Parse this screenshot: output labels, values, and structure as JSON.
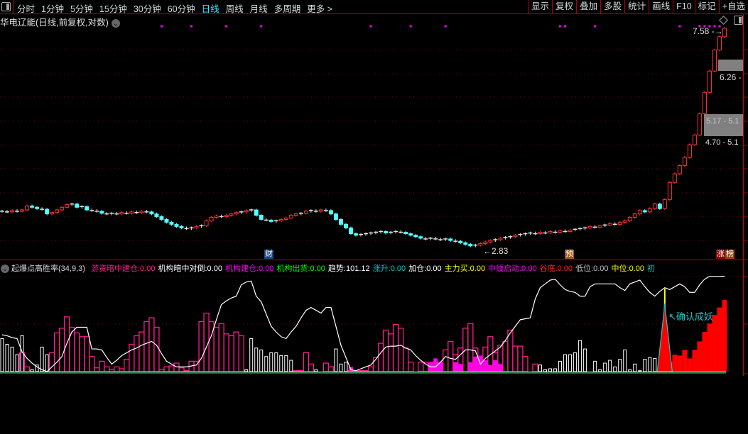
{
  "toolbar": {
    "periods": [
      "分时",
      "1分钟",
      "5分钟",
      "15分钟",
      "30分钟",
      "60分钟",
      "日线",
      "周线",
      "月线",
      "多周期",
      "更多 >"
    ],
    "active_period": "日线",
    "buttons": [
      "显示",
      "复权",
      "叠加",
      "多股",
      "统计",
      "画线",
      "F10",
      "标记",
      "+自选"
    ]
  },
  "chart_title": "华电辽能(日线,前复权,对数)",
  "price_labels": {
    "high": "7.58",
    "low": "2.83",
    "level1": "6.26 -",
    "level2_box": "5.17 - 5.1",
    "level3": "4.70 - 5.1"
  },
  "markers": {
    "cai": "财",
    "yu": "预",
    "zhang": "涨",
    "bang": "榜"
  },
  "annotation": "确认成妖",
  "indicator": {
    "name": "起爆点高胜率(34,9,3)",
    "items": [
      {
        "label": "游资暗中建仓:",
        "value": "0.00",
        "color": "#ff1a8c"
      },
      {
        "label": "机构暗中对倒:",
        "value": "0.00",
        "color": "#ffffff"
      },
      {
        "label": "机构建仓:",
        "value": "0.00",
        "color": "#ff00ff"
      },
      {
        "label": "机构出货:",
        "value": "0.00",
        "color": "#00ff00"
      },
      {
        "label": "趋势:",
        "value": "101.12",
        "color": "#ffffff"
      },
      {
        "label": "涨升:",
        "value": "0.00",
        "color": "#00c8c8"
      },
      {
        "label": "加仓:",
        "value": "0.00",
        "color": "#ffffff"
      },
      {
        "label": "主力买:",
        "value": "0.00",
        "color": "#ffff00"
      },
      {
        "label": "中线启动:",
        "value": "0.00",
        "color": "#ff00ff"
      },
      {
        "label": "谷底:",
        "value": "0.00",
        "color": "#ff2020"
      },
      {
        "label": "低位:",
        "value": "0.00",
        "color": "#c0c0c0"
      },
      {
        "label": "中位:",
        "value": "0.00",
        "color": "#ffff00"
      },
      {
        "label": "初",
        "value": "",
        "color": "#00c8c8"
      }
    ]
  },
  "colors": {
    "up": "#ff3232",
    "down": "#54ffff",
    "grid": "#8b0000",
    "accent": "#40e0ff"
  },
  "chart_data": [
    {
      "type": "candlestick",
      "scale": "log",
      "closes": [
        3.34,
        3.33,
        3.35,
        3.34,
        3.36,
        3.42,
        3.4,
        3.38,
        3.37,
        3.3,
        3.32,
        3.36,
        3.4,
        3.44,
        3.45,
        3.4,
        3.41,
        3.36,
        3.35,
        3.34,
        3.31,
        3.3,
        3.31,
        3.3,
        3.32,
        3.31,
        3.33,
        3.32,
        3.34,
        3.33,
        3.3,
        3.26,
        3.22,
        3.18,
        3.15,
        3.12,
        3.1,
        3.09,
        3.1,
        3.12,
        3.13,
        3.2,
        3.25,
        3.27,
        3.26,
        3.28,
        3.3,
        3.32,
        3.33,
        3.35,
        3.36,
        3.28,
        3.22,
        3.21,
        3.19,
        3.2,
        3.22,
        3.24,
        3.28,
        3.3,
        3.31,
        3.34,
        3.35,
        3.34,
        3.36,
        3.35,
        3.3,
        3.22,
        3.15,
        3.1,
        3.02,
        3.0,
        3.01,
        3.02,
        3.03,
        3.04,
        3.05,
        3.03,
        3.04,
        3.05,
        3.04,
        3.02,
        3.0,
        2.98,
        2.96,
        2.95,
        2.96,
        2.95,
        2.94,
        2.95,
        2.93,
        2.92,
        2.9,
        2.88,
        2.86,
        2.87,
        2.89,
        2.91,
        2.93,
        2.94,
        2.96,
        2.97,
        2.98,
        3.0,
        3.01,
        3.02,
        3.03,
        3.02,
        3.04,
        3.03,
        3.05,
        3.04,
        3.06,
        3.05,
        3.07,
        3.08,
        3.09,
        3.1,
        3.12,
        3.11,
        3.13,
        3.14,
        3.16,
        3.15,
        3.18,
        3.2,
        3.25,
        3.3,
        3.35,
        3.33,
        3.38,
        3.45,
        3.38,
        3.52,
        3.8,
        3.95,
        4.1,
        4.25,
        4.5,
        4.7,
        5.17,
        5.69,
        6.26,
        6.88,
        7.3,
        7.58
      ],
      "signal_dot_indices": [
        32,
        38,
        45,
        52,
        74,
        82,
        89,
        112,
        113,
        119,
        136,
        140,
        141,
        142,
        143,
        144
      ]
    },
    {
      "type": "bar+line",
      "ylim": [
        0,
        101.12
      ],
      "trend": [
        39,
        38,
        36,
        35,
        21,
        14,
        9,
        5,
        2,
        0,
        5,
        10,
        16,
        30,
        42,
        47,
        47,
        47,
        24,
        24,
        23,
        15,
        8,
        12,
        17,
        20,
        23,
        25,
        28,
        30,
        32,
        28,
        19,
        11,
        8,
        5,
        5,
        5,
        6,
        7,
        14,
        26,
        38,
        55,
        71,
        75,
        78,
        80,
        92,
        95,
        96,
        80,
        74,
        61,
        48,
        42,
        37,
        35,
        42,
        48,
        57,
        65,
        68,
        65,
        62,
        68,
        68,
        48,
        28,
        15,
        2,
        1,
        3,
        5,
        7,
        13,
        20,
        26,
        27,
        27,
        28,
        25,
        23,
        17,
        12,
        8,
        5,
        5,
        10,
        16,
        14,
        13,
        18,
        23,
        23,
        22,
        8,
        14,
        18,
        22,
        26,
        33,
        41,
        48,
        55,
        56,
        57,
        77,
        89,
        93,
        97,
        98,
        92,
        87,
        85,
        84,
        80,
        80,
        90,
        93,
        93,
        93,
        93,
        93,
        89,
        86,
        93,
        95,
        97,
        90,
        84,
        80,
        85,
        89,
        87,
        90,
        93,
        90,
        84,
        84,
        92,
        98,
        101,
        101,
        101,
        101.12
      ],
      "youzi_jiancang": [
        0,
        0,
        0,
        0,
        20,
        5,
        0,
        0,
        0,
        0,
        20,
        41,
        46,
        58,
        47,
        41,
        37,
        37,
        16,
        4,
        11,
        5,
        2,
        5,
        3,
        13,
        29,
        38,
        42,
        53,
        57,
        47,
        2,
        5,
        6,
        9,
        4,
        1,
        11,
        11,
        53,
        62,
        53,
        47,
        51,
        40,
        38,
        42,
        38,
        0,
        0,
        0,
        0,
        0,
        0,
        0,
        0,
        0,
        0,
        1,
        1,
        20,
        8,
        0,
        0,
        9,
        5,
        0,
        0,
        0,
        1,
        1,
        1,
        1,
        5,
        15,
        30,
        44,
        40,
        50,
        46,
        25,
        10,
        0,
        10,
        10,
        5,
        10,
        0,
        23,
        32,
        18,
        25,
        46,
        51,
        25,
        0,
        26,
        37,
        20,
        28,
        32,
        44,
        27,
        27,
        16,
        0,
        8,
        0,
        0,
        0,
        0,
        0,
        0,
        0,
        0,
        0,
        0,
        0,
        0,
        0,
        0,
        0,
        0,
        0,
        0,
        0,
        0,
        0,
        0,
        0,
        0,
        0,
        0,
        0,
        0,
        0,
        0,
        0,
        0,
        0,
        0,
        0,
        0,
        0,
        0
      ],
      "jigou_jiancang": [
        0,
        0,
        0,
        0,
        0,
        0,
        0,
        0,
        0,
        0,
        0,
        0,
        0,
        0,
        0,
        0,
        0,
        0,
        0,
        0,
        0,
        0,
        0,
        0,
        0,
        0,
        0,
        0,
        0,
        0,
        0,
        0,
        0,
        0,
        0,
        0,
        0,
        0,
        0,
        0,
        0,
        0,
        0,
        0,
        0,
        0,
        0,
        0,
        0,
        0,
        0,
        0,
        0,
        0,
        0,
        0,
        0,
        0,
        0,
        0,
        0,
        0,
        0,
        0,
        0,
        0,
        0,
        0,
        0,
        0,
        5,
        0,
        0,
        0,
        0,
        0,
        0,
        0,
        0,
        0,
        0,
        0,
        0,
        0,
        0,
        0,
        10,
        14,
        10,
        0,
        0,
        10,
        8,
        0,
        10,
        16,
        17,
        12,
        7,
        12,
        8,
        0,
        0,
        0,
        0,
        0,
        0,
        0,
        0,
        0,
        0,
        0,
        0,
        0,
        0,
        0,
        0,
        0,
        0,
        0,
        0,
        0,
        0,
        0,
        0,
        0,
        0,
        0,
        0,
        0,
        0,
        0,
        0,
        0,
        0,
        0,
        0,
        0,
        0,
        0,
        0,
        0,
        0,
        0,
        0,
        0
      ],
      "jigou_duidao": [
        35,
        29,
        26,
        18,
        38,
        0,
        2,
        7,
        26,
        18,
        0,
        0,
        0,
        0,
        0,
        0,
        0,
        0,
        0,
        0,
        0,
        0,
        0,
        0,
        0,
        0,
        0,
        0,
        0,
        0,
        0,
        0,
        0,
        0,
        0,
        0,
        0,
        0,
        0,
        0,
        0,
        0,
        0,
        0,
        0,
        0,
        0,
        0,
        0,
        2,
        35,
        25,
        23,
        16,
        20,
        20,
        17,
        17,
        12,
        0,
        0,
        0,
        0,
        2,
        0,
        0,
        0,
        24,
        8,
        10,
        0,
        0,
        0,
        0,
        0,
        0,
        0,
        0,
        0,
        0,
        0,
        0,
        0,
        0,
        0,
        0,
        0,
        0,
        0,
        0,
        0,
        0,
        0,
        0,
        0,
        0,
        0,
        0,
        0,
        0,
        0,
        0,
        0,
        0,
        0,
        0,
        0,
        0,
        7,
        2,
        3,
        3,
        11,
        18,
        18,
        20,
        33,
        24,
        0,
        11,
        2,
        9,
        12,
        5,
        13,
        23,
        2,
        8,
        1,
        13,
        15,
        14,
        7,
        0,
        0,
        0,
        0,
        0,
        0,
        0,
        0,
        0,
        0,
        0,
        0,
        0
      ],
      "red_bars": [
        0,
        0,
        0,
        0,
        0,
        0,
        0,
        0,
        0,
        0,
        0,
        0,
        0,
        0,
        0,
        0,
        0,
        0,
        0,
        0,
        0,
        0,
        0,
        0,
        0,
        0,
        0,
        0,
        0,
        0,
        0,
        0,
        0,
        0,
        0,
        0,
        0,
        0,
        0,
        0,
        0,
        0,
        0,
        0,
        0,
        0,
        0,
        0,
        0,
        0,
        0,
        0,
        0,
        0,
        0,
        0,
        0,
        0,
        0,
        0,
        0,
        0,
        0,
        0,
        0,
        0,
        0,
        0,
        0,
        0,
        0,
        0,
        0,
        0,
        0,
        0,
        0,
        0,
        0,
        0,
        0,
        0,
        0,
        0,
        0,
        0,
        0,
        0,
        0,
        0,
        0,
        0,
        0,
        0,
        0,
        0,
        0,
        0,
        0,
        0,
        0,
        0,
        0,
        0,
        0,
        0,
        0,
        0,
        0,
        0,
        0,
        0,
        0,
        0,
        0,
        0,
        0,
        0,
        0,
        0,
        0,
        0,
        0,
        0,
        0,
        0,
        0,
        0,
        0,
        0,
        0,
        0,
        0,
        0,
        10,
        18,
        17,
        23,
        14,
        23,
        32,
        42,
        51,
        60,
        68,
        76
      ],
      "spike_index": 133,
      "spike_value": 80
    }
  ]
}
